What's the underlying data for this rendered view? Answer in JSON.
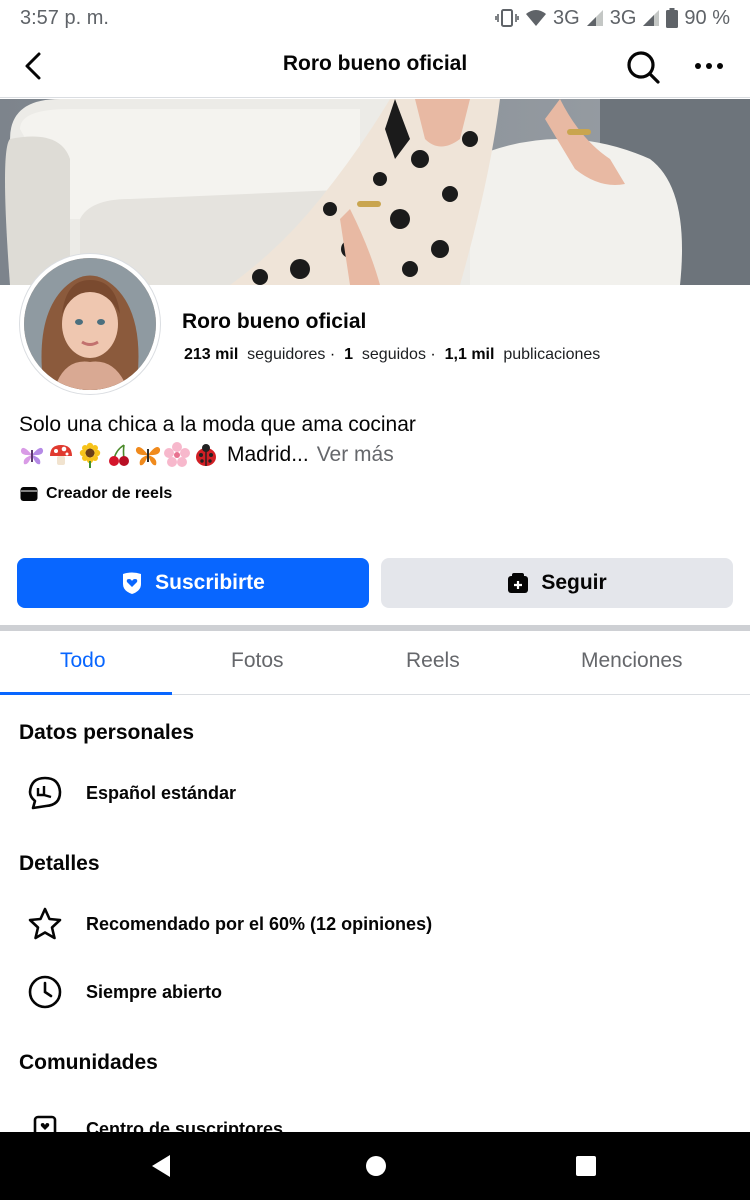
{
  "status_bar": {
    "time": "3:57 p. m.",
    "network1": "3G",
    "network2": "3G",
    "battery": "90 %"
  },
  "header": {
    "title": "Roro bueno oficial"
  },
  "profile": {
    "name": "Roro bueno oficial",
    "followers_count": "213 mil",
    "followers_label": "seguidores",
    "following_count": "1",
    "following_label": "seguidos",
    "posts_count": "1,1 mil",
    "posts_label": "publicaciones",
    "separator": "·"
  },
  "bio": {
    "line1": "Solo una chica a la moda que ama cocinar",
    "line2_text": "Madrid...",
    "see_more": "Ver más",
    "emojis": [
      "butterfly-pink",
      "mushroom",
      "sunflower",
      "cherries",
      "butterfly-orange",
      "cherry-blossom",
      "ladybug"
    ]
  },
  "creator": {
    "label": "Creador de reels"
  },
  "actions": {
    "subscribe": "Suscribirte",
    "follow": "Seguir",
    "subscribe_color": "#0866ff"
  },
  "tabs": [
    {
      "label": "Todo",
      "active": true
    },
    {
      "label": "Fotos",
      "active": false
    },
    {
      "label": "Reels",
      "active": false
    },
    {
      "label": "Menciones",
      "active": false
    }
  ],
  "sections": {
    "personal": {
      "title": "Datos personales",
      "items": [
        {
          "icon": "language-bubble-icon",
          "text": "Español estándar"
        }
      ]
    },
    "details": {
      "title": "Detalles",
      "items": [
        {
          "icon": "star-icon",
          "text": "Recomendado por el 60% (12 opiniones)"
        },
        {
          "icon": "clock-icon",
          "text": "Siempre abierto"
        }
      ]
    },
    "communities": {
      "title": "Comunidades",
      "items": [
        {
          "icon": "subscriber-icon",
          "text": "Centro de suscriptores"
        }
      ]
    }
  }
}
